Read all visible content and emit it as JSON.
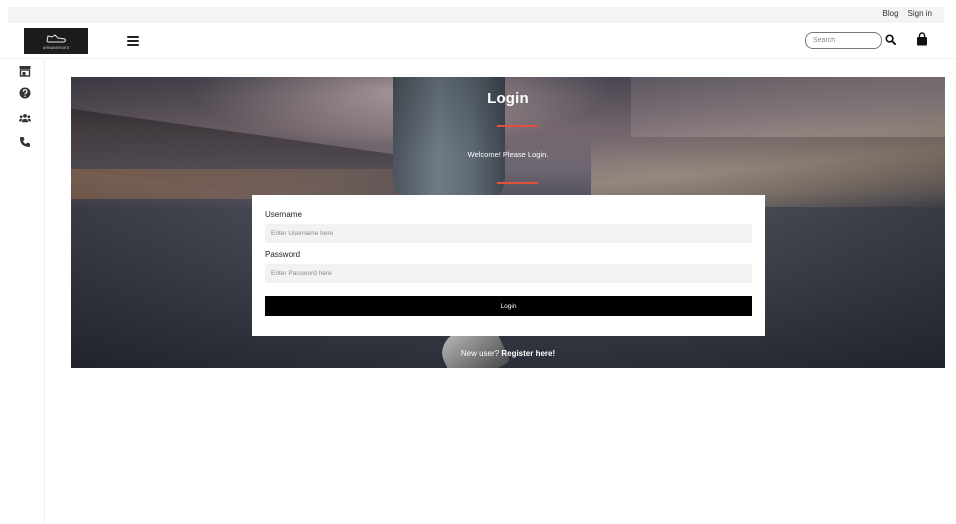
{
  "topbar": {
    "links": [
      "Blog",
      "Sign in"
    ]
  },
  "header": {
    "logo_text": "URBANSHOES",
    "search": {
      "placeholder": "Search",
      "value": ""
    },
    "icons": [
      "menu-icon",
      "search-icon",
      "shopping-bag-icon"
    ]
  },
  "sidebar": {
    "icons": [
      "store-icon",
      "question-circle-icon",
      "users-icon",
      "phone-icon"
    ]
  },
  "hero": {
    "title": "Login",
    "welcome": "Welcome! Please Login.",
    "accent_color": "#e0503d"
  },
  "form": {
    "username_label": "Username",
    "username_placeholder": "Enter Username here",
    "password_label": "Password",
    "password_placeholder": "Enter Password here",
    "submit_label": "Login"
  },
  "register": {
    "prompt": "New user?",
    "link": "Register here!"
  }
}
